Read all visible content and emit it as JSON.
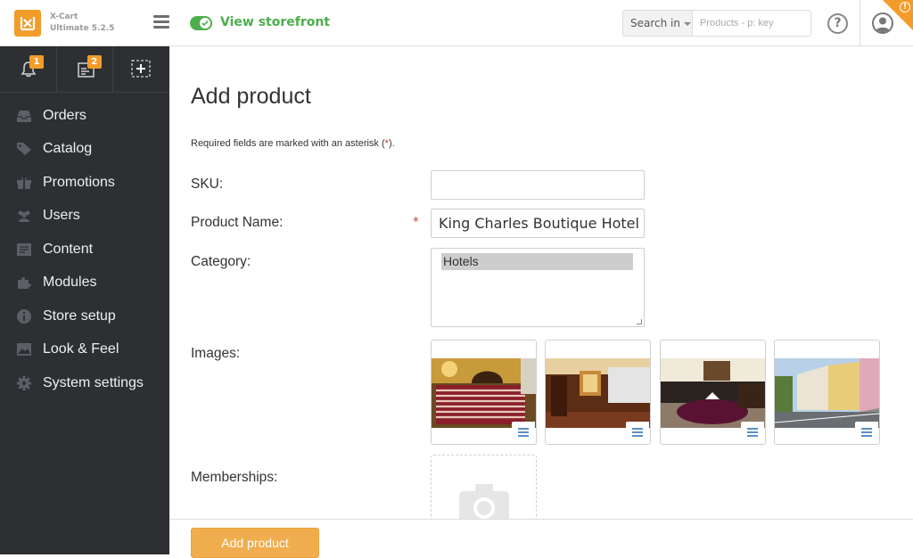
{
  "header": {
    "brand_name": "X-Cart",
    "brand_version": "Ultimate 5.2.5",
    "storefront_label": "View storefront",
    "search_in_label": "Search in",
    "search_placeholder": "Products - p: key",
    "help_label": "?",
    "corner_badge": "!"
  },
  "quick_links": [
    {
      "name": "notifications",
      "badge": "1",
      "icon": "bell-icon"
    },
    {
      "name": "orders-pending",
      "badge": "2",
      "icon": "orders-tray-icon"
    },
    {
      "name": "add-new",
      "badge": "",
      "icon": "plus-box-icon"
    }
  ],
  "sidebar": {
    "items": [
      {
        "label": "Orders",
        "icon": "orders-icon"
      },
      {
        "label": "Catalog",
        "icon": "tag-icon"
      },
      {
        "label": "Promotions",
        "icon": "gift-icon"
      },
      {
        "label": "Users",
        "icon": "users-icon"
      },
      {
        "label": "Content",
        "icon": "content-icon"
      },
      {
        "label": "Modules",
        "icon": "puzzle-icon"
      },
      {
        "label": "Store setup",
        "icon": "info-icon"
      },
      {
        "label": "Look & Feel",
        "icon": "image-icon"
      },
      {
        "label": "System settings",
        "icon": "gear-icon"
      }
    ]
  },
  "page": {
    "title": "Add product",
    "required_note_prefix": "Required fields are marked with an asterisk (",
    "required_note_star": "*",
    "required_note_suffix": ").",
    "fields": {
      "sku_label": "SKU:",
      "sku_value": "",
      "name_label": "Product Name:",
      "name_value": "King Charles Boutique Hotel Re",
      "category_label": "Category:",
      "category_selected": "Hotels",
      "images_label": "Images:",
      "memberships_label": "Memberships:"
    },
    "images": [
      {
        "alt": "hotel-room-striped-bed"
      },
      {
        "alt": "hotel-hallway"
      },
      {
        "alt": "hotel-dining-room"
      },
      {
        "alt": "hotel-street-view"
      }
    ]
  },
  "footer": {
    "submit_label": "Add product"
  },
  "colors": {
    "brand_orange": "#f39c2a",
    "sidebar_bg": "#2d2f33",
    "storefront_green": "#4cae4c",
    "button_orange": "#f0ad4e"
  }
}
